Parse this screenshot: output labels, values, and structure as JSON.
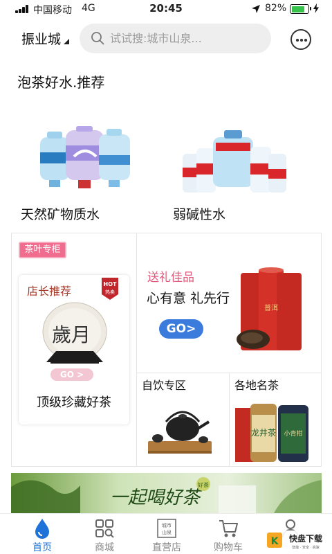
{
  "status_bar": {
    "carrier": "中国移动",
    "network": "4G",
    "time": "20:45",
    "battery_percent": "82%",
    "battery_level": 0.82
  },
  "header": {
    "city": "振业城",
    "search_placeholder": "试试搜:城市山泉...",
    "icons": {
      "search": "search-icon",
      "message": "message-icon"
    }
  },
  "section": {
    "title": "泡茶好水.推荐"
  },
  "products": [
    {
      "label": "天然矿物质水",
      "icon": "mineral-water-image"
    },
    {
      "label": "弱碱性水",
      "icon": "alkaline-water-image"
    }
  ],
  "promo": {
    "tea_tag": "茶叶专柜",
    "manager_pick": "店长推荐",
    "hot_badge_top": "HOT",
    "hot_badge_bottom": "热卖",
    "cake_text": "歲月",
    "small_go": "GO >",
    "tea_card_title": "顶级珍藏好茶",
    "gift_title": "送礼佳品",
    "gift_subtitle": "心有意  礼先行",
    "gift_go": "GO>",
    "gift_can_text": "普洱",
    "self_drink": "自饮专区",
    "regional_tea": "各地名茶",
    "longjing": "龙井茶",
    "small_can_text": "小青柑"
  },
  "banner": {
    "slogan": "一起喝好茶",
    "seal": "好茶"
  },
  "tabbar": {
    "active_index": 0,
    "active_color": "#1f72d8",
    "items": [
      {
        "label": "首页",
        "icon": "water-drop-icon"
      },
      {
        "label": "商城",
        "icon": "grid-search-icon"
      },
      {
        "label": "直营店",
        "icon": "store-icon",
        "icon_text": "城市山泉"
      },
      {
        "label": "购物车",
        "icon": "cart-icon"
      },
      {
        "label": "",
        "icon": "user-icon"
      }
    ]
  },
  "watermark": {
    "text": "快盘下载",
    "sub": "智能 · 安全 · 高速"
  }
}
